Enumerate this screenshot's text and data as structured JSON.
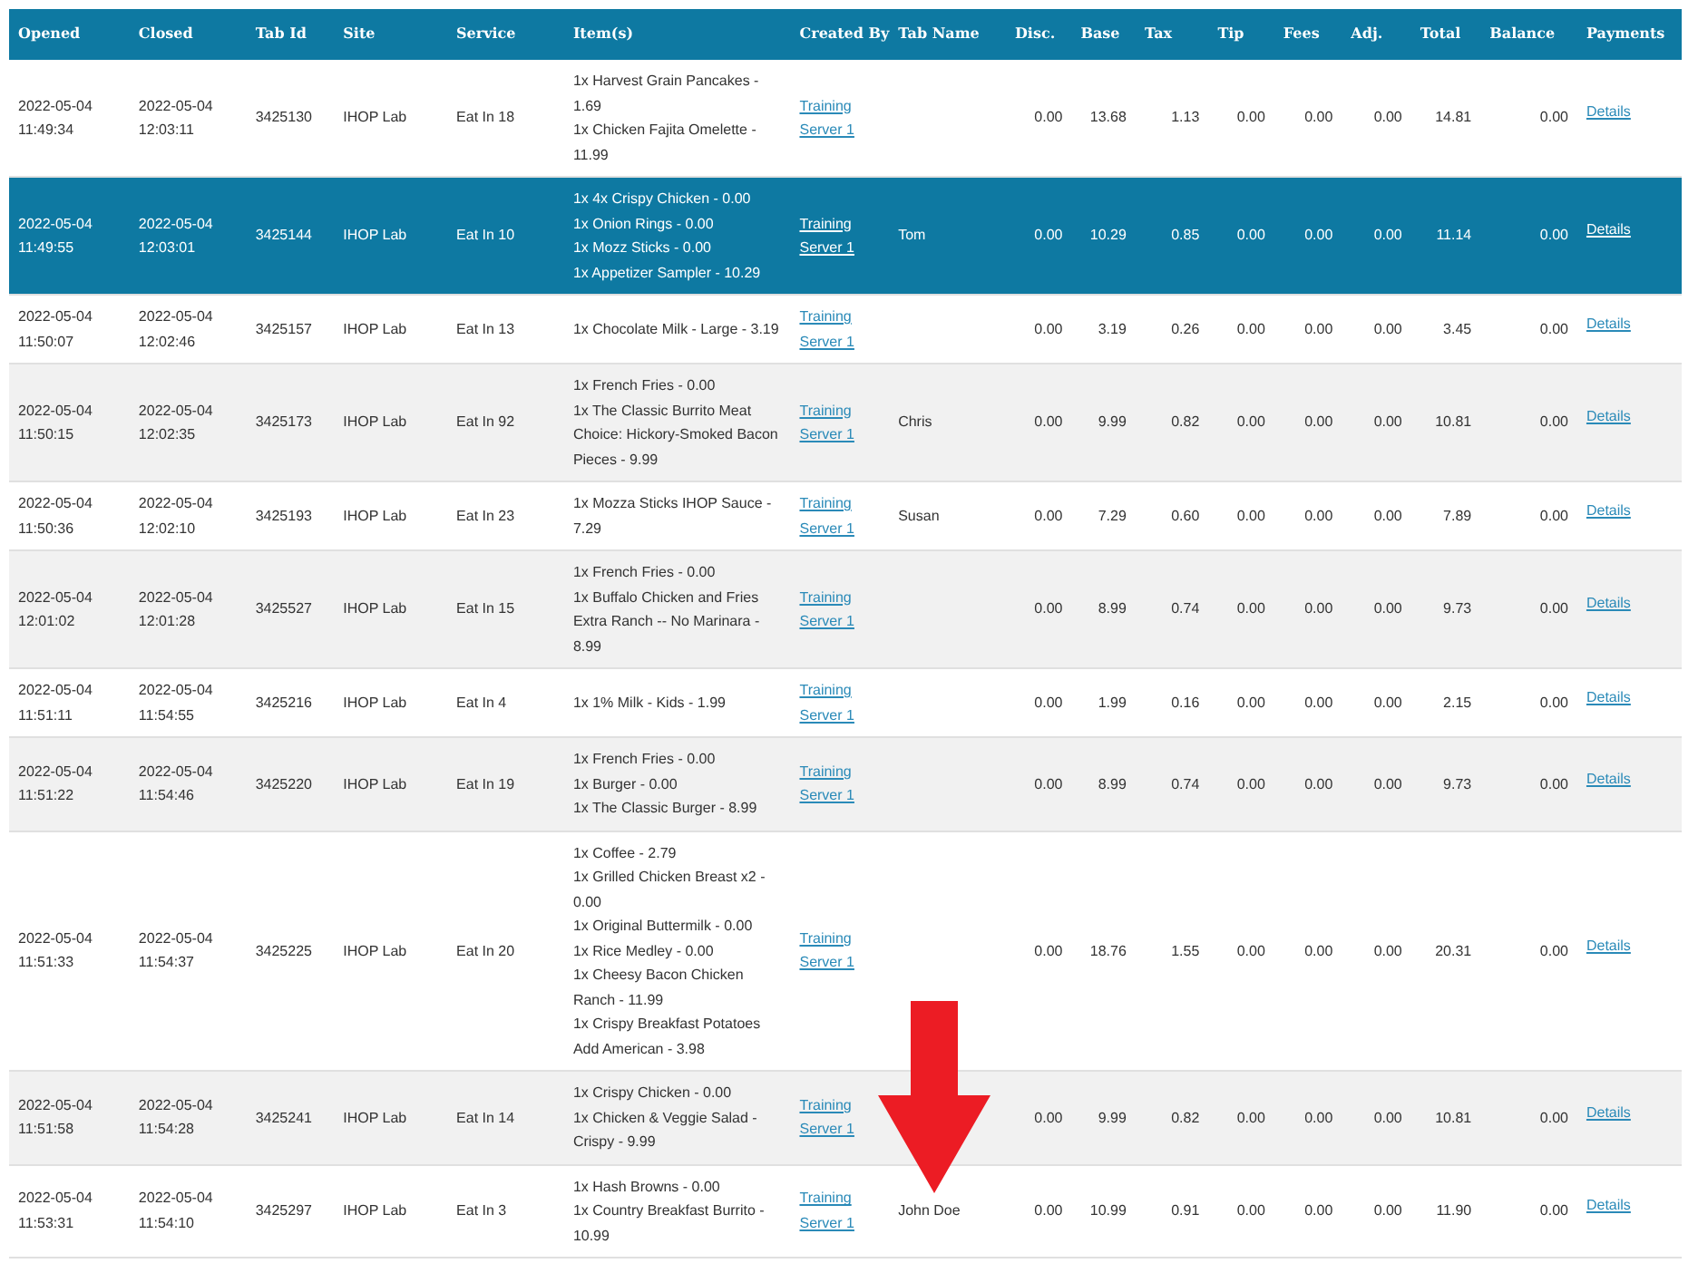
{
  "table": {
    "columns": [
      "Opened",
      "Closed",
      "Tab Id",
      "Site",
      "Service",
      "Item(s)",
      "Created By",
      "Tab Name",
      "Disc.",
      "Base",
      "Tax",
      "Tip",
      "Fees",
      "Adj.",
      "Total",
      "Balance",
      "Payments"
    ],
    "rows": [
      {
        "selected": false,
        "opened": "2022-05-04 11:49:34",
        "closed": "2022-05-04 12:03:11",
        "tab_id": "3425130",
        "site": "IHOP Lab",
        "service": "Eat In 18",
        "items": [
          "1x Harvest Grain Pancakes - 1.69",
          "1x Chicken Fajita Omelette - 11.99"
        ],
        "created_by": "Training Server 1",
        "tab_name": "",
        "disc": "0.00",
        "base": "13.68",
        "tax": "1.13",
        "tip": "0.00",
        "fees": "0.00",
        "adj": "0.00",
        "total": "14.81",
        "balance": "0.00",
        "payments": "Details"
      },
      {
        "selected": true,
        "opened": "2022-05-04 11:49:55",
        "closed": "2022-05-04 12:03:01",
        "tab_id": "3425144",
        "site": "IHOP Lab",
        "service": "Eat In 10",
        "items": [
          "1x 4x Crispy Chicken - 0.00",
          "1x Onion Rings - 0.00",
          "1x Mozz Sticks - 0.00",
          "1x Appetizer Sampler - 10.29"
        ],
        "created_by": "Training Server 1",
        "tab_name": "Tom",
        "disc": "0.00",
        "base": "10.29",
        "tax": "0.85",
        "tip": "0.00",
        "fees": "0.00",
        "adj": "0.00",
        "total": "11.14",
        "balance": "0.00",
        "payments": "Details"
      },
      {
        "selected": false,
        "opened": "2022-05-04 11:50:07",
        "closed": "2022-05-04 12:02:46",
        "tab_id": "3425157",
        "site": "IHOP Lab",
        "service": "Eat In 13",
        "items": [
          "1x Chocolate Milk - Large - 3.19"
        ],
        "created_by": "Training Server 1",
        "tab_name": "",
        "disc": "0.00",
        "base": "3.19",
        "tax": "0.26",
        "tip": "0.00",
        "fees": "0.00",
        "adj": "0.00",
        "total": "3.45",
        "balance": "0.00",
        "payments": "Details"
      },
      {
        "selected": false,
        "opened": "2022-05-04 11:50:15",
        "closed": "2022-05-04 12:02:35",
        "tab_id": "3425173",
        "site": "IHOP Lab",
        "service": "Eat In 92",
        "items": [
          "1x French Fries - 0.00",
          "1x The Classic Burrito Meat Choice: Hickory-Smoked Bacon Pieces - 9.99"
        ],
        "created_by": "Training Server 1",
        "tab_name": "Chris",
        "disc": "0.00",
        "base": "9.99",
        "tax": "0.82",
        "tip": "0.00",
        "fees": "0.00",
        "adj": "0.00",
        "total": "10.81",
        "balance": "0.00",
        "payments": "Details"
      },
      {
        "selected": false,
        "opened": "2022-05-04 11:50:36",
        "closed": "2022-05-04 12:02:10",
        "tab_id": "3425193",
        "site": "IHOP Lab",
        "service": "Eat In 23",
        "items": [
          "1x Mozza Sticks IHOP Sauce - 7.29"
        ],
        "created_by": "Training Server 1",
        "tab_name": "Susan",
        "disc": "0.00",
        "base": "7.29",
        "tax": "0.60",
        "tip": "0.00",
        "fees": "0.00",
        "adj": "0.00",
        "total": "7.89",
        "balance": "0.00",
        "payments": "Details"
      },
      {
        "selected": false,
        "opened": "2022-05-04 12:01:02",
        "closed": "2022-05-04 12:01:28",
        "tab_id": "3425527",
        "site": "IHOP Lab",
        "service": "Eat In 15",
        "items": [
          "1x French Fries - 0.00",
          "1x Buffalo Chicken and Fries Extra Ranch -- No Marinara - 8.99"
        ],
        "created_by": "Training Server 1",
        "tab_name": "",
        "disc": "0.00",
        "base": "8.99",
        "tax": "0.74",
        "tip": "0.00",
        "fees": "0.00",
        "adj": "0.00",
        "total": "9.73",
        "balance": "0.00",
        "payments": "Details"
      },
      {
        "selected": false,
        "opened": "2022-05-04 11:51:11",
        "closed": "2022-05-04 11:54:55",
        "tab_id": "3425216",
        "site": "IHOP Lab",
        "service": "Eat In 4",
        "items": [
          "1x 1% Milk - Kids - 1.99"
        ],
        "created_by": "Training Server 1",
        "tab_name": "",
        "disc": "0.00",
        "base": "1.99",
        "tax": "0.16",
        "tip": "0.00",
        "fees": "0.00",
        "adj": "0.00",
        "total": "2.15",
        "balance": "0.00",
        "payments": "Details"
      },
      {
        "selected": false,
        "opened": "2022-05-04 11:51:22",
        "closed": "2022-05-04 11:54:46",
        "tab_id": "3425220",
        "site": "IHOP Lab",
        "service": "Eat In 19",
        "items": [
          "1x French Fries - 0.00",
          "1x Burger - 0.00",
          "1x The Classic Burger - 8.99"
        ],
        "created_by": "Training Server 1",
        "tab_name": "",
        "disc": "0.00",
        "base": "8.99",
        "tax": "0.74",
        "tip": "0.00",
        "fees": "0.00",
        "adj": "0.00",
        "total": "9.73",
        "balance": "0.00",
        "payments": "Details"
      },
      {
        "selected": false,
        "opened": "2022-05-04 11:51:33",
        "closed": "2022-05-04 11:54:37",
        "tab_id": "3425225",
        "site": "IHOP Lab",
        "service": "Eat In 20",
        "items": [
          "1x Coffee - 2.79",
          "1x Grilled Chicken Breast x2 - 0.00",
          "1x Original Buttermilk - 0.00",
          "1x Rice Medley - 0.00",
          "1x Cheesy Bacon Chicken Ranch - 11.99",
          "1x Crispy Breakfast Potatoes Add American - 3.98"
        ],
        "created_by": "Training Server 1",
        "tab_name": "",
        "disc": "0.00",
        "base": "18.76",
        "tax": "1.55",
        "tip": "0.00",
        "fees": "0.00",
        "adj": "0.00",
        "total": "20.31",
        "balance": "0.00",
        "payments": "Details"
      },
      {
        "selected": false,
        "opened": "2022-05-04 11:51:58",
        "closed": "2022-05-04 11:54:28",
        "tab_id": "3425241",
        "site": "IHOP Lab",
        "service": "Eat In 14",
        "items": [
          "1x Crispy Chicken - 0.00",
          "1x Chicken & Veggie Salad - Crispy - 9.99"
        ],
        "created_by": "Training Server 1",
        "tab_name": "",
        "disc": "0.00",
        "base": "9.99",
        "tax": "0.82",
        "tip": "0.00",
        "fees": "0.00",
        "adj": "0.00",
        "total": "10.81",
        "balance": "0.00",
        "payments": "Details"
      },
      {
        "selected": false,
        "opened": "2022-05-04 11:53:31",
        "closed": "2022-05-04 11:54:10",
        "tab_id": "3425297",
        "site": "IHOP Lab",
        "service": "Eat In 3",
        "items": [
          "1x Hash Browns - 0.00",
          "1x Country Breakfast Burrito - 10.99"
        ],
        "created_by": "Training Server 1",
        "tab_name": "John Doe",
        "arrow": true,
        "disc": "0.00",
        "base": "10.99",
        "tax": "0.91",
        "tip": "0.00",
        "fees": "0.00",
        "adj": "0.00",
        "total": "11.90",
        "balance": "0.00",
        "payments": "Details"
      }
    ]
  }
}
